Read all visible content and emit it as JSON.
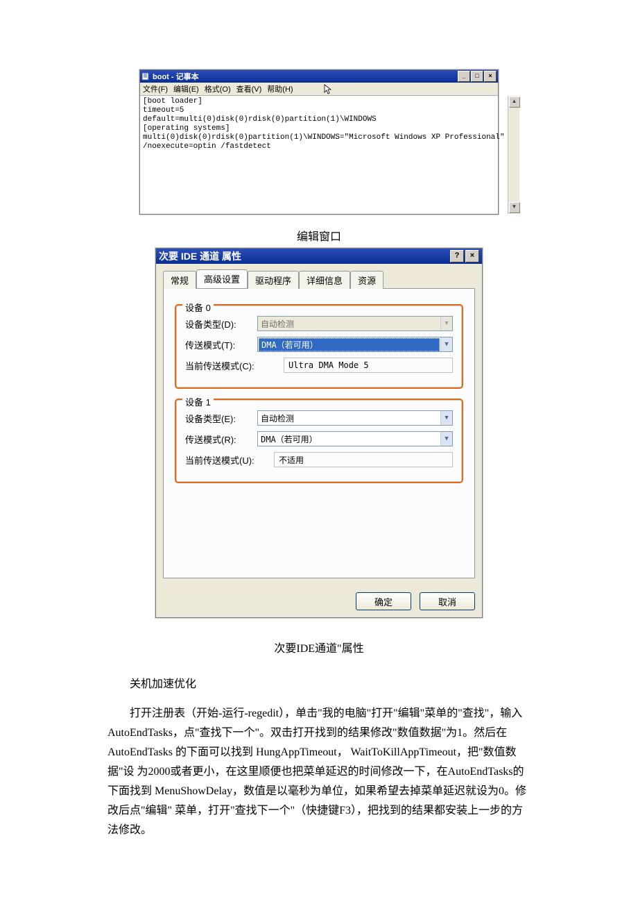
{
  "notepad": {
    "title": "boot - 记事本",
    "menu": {
      "file": "文件(F)",
      "edit": "编辑(E)",
      "format": "格式(O)",
      "view": "查看(V)",
      "help": "帮助(H)"
    },
    "content": "[boot loader]\ntimeout=5\ndefault=multi(0)disk(0)rdisk(0)partition(1)\\WINDOWS\n[operating systems]\nmulti(0)disk(0)rdisk(0)partition(1)\\WINDOWS=\"Microsoft Windows XP Professional\"\n/noexecute=optin /fastdetect",
    "winbtn": {
      "min": "_",
      "max": "□",
      "close": "×"
    },
    "scroll": {
      "up": "▲",
      "down": "▼"
    }
  },
  "caption_notepad": "编辑窗口",
  "props": {
    "title": "次要 IDE 通道 属性",
    "winbtn": {
      "help": "?",
      "close": "×"
    },
    "tabs": {
      "general": "常规",
      "advanced": "高级设置",
      "driver": "驱动程序",
      "details": "详细信息",
      "resources": "资源"
    },
    "device0": {
      "legend": "设备 0",
      "type_label": "设备类型(D):",
      "type_value": "自动检测",
      "mode_label": "传送模式(T):",
      "mode_value": "DMA（若可用）",
      "cur_label": "当前传送模式(C):",
      "cur_value": "Ultra DMA Mode 5"
    },
    "device1": {
      "legend": "设备 1",
      "type_label": "设备类型(E):",
      "type_value": "自动检测",
      "mode_label": "传送模式(R):",
      "mode_value": "DMA（若可用）",
      "cur_label": "当前传送模式(U):",
      "cur_value": "不适用"
    },
    "buttons": {
      "ok": "确定",
      "cancel": "取消"
    }
  },
  "caption_props": "次要IDE通道\"属性",
  "article": {
    "heading": "关机加速优化",
    "body": "打开注册表（开始-运行-regedit），单击\"我的电脑\"打开\"编辑\"菜单的\"查找\"，输入 AutoEndTasks，点\"查找下一个\"。双击打开找到的结果修改\"数值数据\"为1。然后在 AutoEndTasks 的下面可以找到 HungAppTimeout，  WaitToKillAppTimeout，把\"数值数据\"设 为2000或者更小，在这里顺便也把菜单延迟的时间修改一下，在AutoEndTasks的下面找到 MenuShowDelay，数值是以毫秒为单位，如果希望去掉菜单延迟就设为0。修改后点\"编辑\"  菜单，打开\"查找下一个\"（快捷键F3），把找到的结果都安装上一步的方法修改。"
  }
}
